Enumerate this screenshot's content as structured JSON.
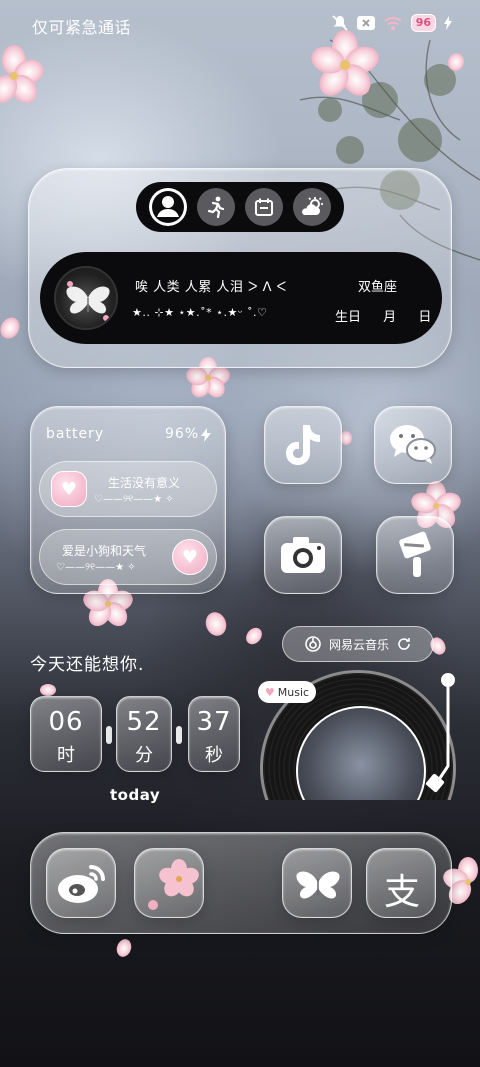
{
  "status_bar": {
    "emergency_text": "仅可紧急通话",
    "battery_level": "96",
    "icons": [
      "mute-icon",
      "sim-off-icon",
      "wifi-icon",
      "battery-icon",
      "charging-icon"
    ]
  },
  "profile_widget": {
    "tabs": [
      {
        "icon": "person-icon",
        "active": true
      },
      {
        "icon": "running-icon",
        "active": false
      },
      {
        "icon": "calendar-icon",
        "active": false
      },
      {
        "icon": "weather-icon",
        "active": false
      }
    ],
    "motto": "唉 人类 人累 人泪 ᐳ ᐱ ᐸ",
    "stars": "★.. ⊹★  ⋆★.˚* ⋆.★ᵕ ˚.♡",
    "zodiac": "双鱼座",
    "birthday_label": "生日",
    "month_label": "月",
    "day_label": "日"
  },
  "battery_widget": {
    "label": "battery",
    "percent": "96%",
    "rows": [
      {
        "text": "生活没有意义",
        "deco": "♡——୨୧——★ ✧"
      },
      {
        "text": "爱是小狗和天气",
        "deco": "♡——୨୧——★ ✧"
      }
    ]
  },
  "apps": {
    "tiktok": "tiktok-icon",
    "wechat": "wechat-icon",
    "camera": "camera-icon",
    "theme": "paint-roller-icon"
  },
  "music_widget": {
    "app_name": "网易云音乐",
    "tag": "Music"
  },
  "clock_widget": {
    "heading": "今天还能想你.",
    "hours": "06",
    "hours_unit": "时",
    "minutes": "52",
    "minutes_unit": "分",
    "seconds": "37",
    "seconds_unit": "秒",
    "caption": "today"
  },
  "dock": {
    "apps": [
      "weibo-icon",
      "blossom-icon",
      "butterfly-icon",
      "alipay-icon"
    ],
    "alipay_glyph": "支"
  },
  "colors": {
    "accent_pink": "#f2a8c0",
    "panel_black": "#0b0b0d"
  }
}
